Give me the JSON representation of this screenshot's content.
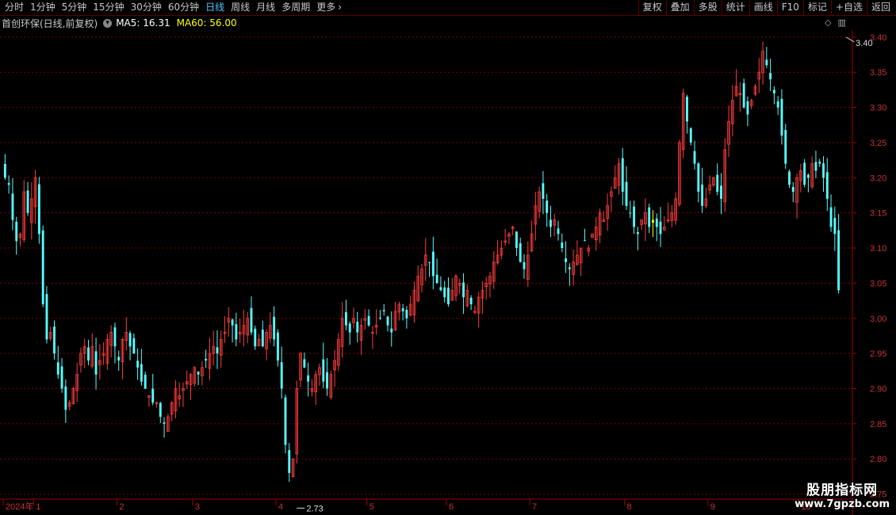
{
  "toolbar": {
    "periods": [
      "分时",
      "1分钟",
      "5分钟",
      "15分钟",
      "30分钟",
      "60分钟",
      "日线",
      "周线",
      "月线",
      "多周期",
      "更多"
    ],
    "active_period": "日线",
    "right_buttons": [
      "复权",
      "叠加",
      "多股",
      "统计",
      "画线",
      "F10",
      "标记",
      "+自选",
      "返回"
    ]
  },
  "stock": {
    "name": "首创环保(日线,前复权)",
    "ma5_label": "MA5: 16.31",
    "ma60_label": "MA60: 56.00"
  },
  "chart_data": {
    "type": "candlestick",
    "price_axis": [
      "3.40",
      "3.35",
      "3.30",
      "3.25",
      "3.20",
      "3.15",
      "3.10",
      "3.05",
      "3.00",
      "2.95",
      "2.90",
      "2.85",
      "2.80",
      "2.75"
    ],
    "ylim": [
      2.745,
      3.41
    ],
    "time_axis": [
      {
        "label": "2024年",
        "index": 0
      },
      {
        "label": "1",
        "index": 8
      },
      {
        "label": "2",
        "index": 30
      },
      {
        "label": "3",
        "index": 50
      },
      {
        "label": "4",
        "index": 72
      },
      {
        "label": "5",
        "index": 96
      },
      {
        "label": "6",
        "index": 117
      },
      {
        "label": "7",
        "index": 139
      },
      {
        "label": "8",
        "index": 164
      },
      {
        "label": "9",
        "index": 186
      },
      {
        "label": "10",
        "index": 210
      }
    ],
    "high_marker": {
      "label": "3.40",
      "value": 3.4,
      "index": 222
    },
    "low_marker": {
      "label": "2.73",
      "value": 2.73,
      "index": 77
    },
    "closes": [
      3.2,
      3.19,
      3.14,
      3.11,
      3.12,
      3.18,
      3.15,
      3.17,
      3.2,
      3.12,
      3.02,
      2.97,
      2.98,
      2.95,
      2.92,
      2.9,
      2.87,
      2.88,
      2.9,
      2.92,
      2.95,
      2.96,
      2.94,
      2.96,
      2.92,
      2.94,
      2.95,
      2.97,
      2.98,
      2.96,
      2.94,
      2.97,
      2.98,
      2.96,
      2.95,
      2.93,
      2.91,
      2.9,
      2.89,
      2.88,
      2.88,
      2.86,
      2.85,
      2.86,
      2.88,
      2.9,
      2.89,
      2.9,
      2.91,
      2.92,
      2.93,
      2.92,
      2.93,
      2.94,
      2.95,
      2.96,
      2.95,
      2.97,
      2.98,
      3.0,
      2.99,
      2.97,
      2.98,
      2.99,
      3.0,
      2.98,
      2.96,
      2.97,
      2.96,
      2.98,
      2.99,
      2.97,
      2.94,
      2.9,
      2.82,
      2.78,
      2.8,
      2.9,
      2.95,
      2.93,
      2.91,
      2.9,
      2.92,
      2.93,
      2.91,
      2.9,
      2.92,
      2.94,
      2.97,
      3.0,
      2.99,
      2.98,
      3.0,
      2.98,
      2.99,
      3.0,
      2.99,
      2.98,
      2.99,
      3.0,
      3.01,
      2.99,
      2.98,
      3.01,
      3.02,
      3.01,
      3.0,
      3.02,
      3.04,
      3.06,
      3.07,
      3.09,
      3.08,
      3.06,
      3.05,
      3.04,
      3.03,
      3.02,
      3.04,
      3.06,
      3.05,
      3.03,
      3.04,
      3.02,
      3.01,
      3.03,
      3.04,
      3.05,
      3.06,
      3.08,
      3.09,
      3.1,
      3.11,
      3.12,
      3.13,
      3.1,
      3.08,
      3.07,
      3.09,
      3.12,
      3.16,
      3.18,
      3.17,
      3.15,
      3.13,
      3.14,
      3.12,
      3.1,
      3.08,
      3.07,
      3.08,
      3.09,
      3.1,
      3.11,
      3.1,
      3.12,
      3.13,
      3.15,
      3.14,
      3.16,
      3.18,
      3.2,
      3.22,
      3.18,
      3.16,
      3.15,
      3.13,
      3.12,
      3.14,
      3.15,
      3.13,
      3.14,
      3.13,
      3.12,
      3.13,
      3.14,
      3.15,
      3.17,
      3.25,
      3.32,
      3.28,
      3.25,
      3.22,
      3.18,
      3.16,
      3.17,
      3.19,
      3.2,
      3.18,
      3.17,
      3.24,
      3.28,
      3.31,
      3.33,
      3.32,
      3.3,
      3.29,
      3.31,
      3.33,
      3.35,
      3.38,
      3.36,
      3.34,
      3.32,
      3.3,
      3.26,
      3.22,
      3.19,
      3.18,
      3.2,
      3.21,
      3.19,
      3.2,
      3.22,
      3.21,
      3.22,
      3.2,
      3.17,
      3.13,
      3.12,
      3.04
    ]
  }
}
